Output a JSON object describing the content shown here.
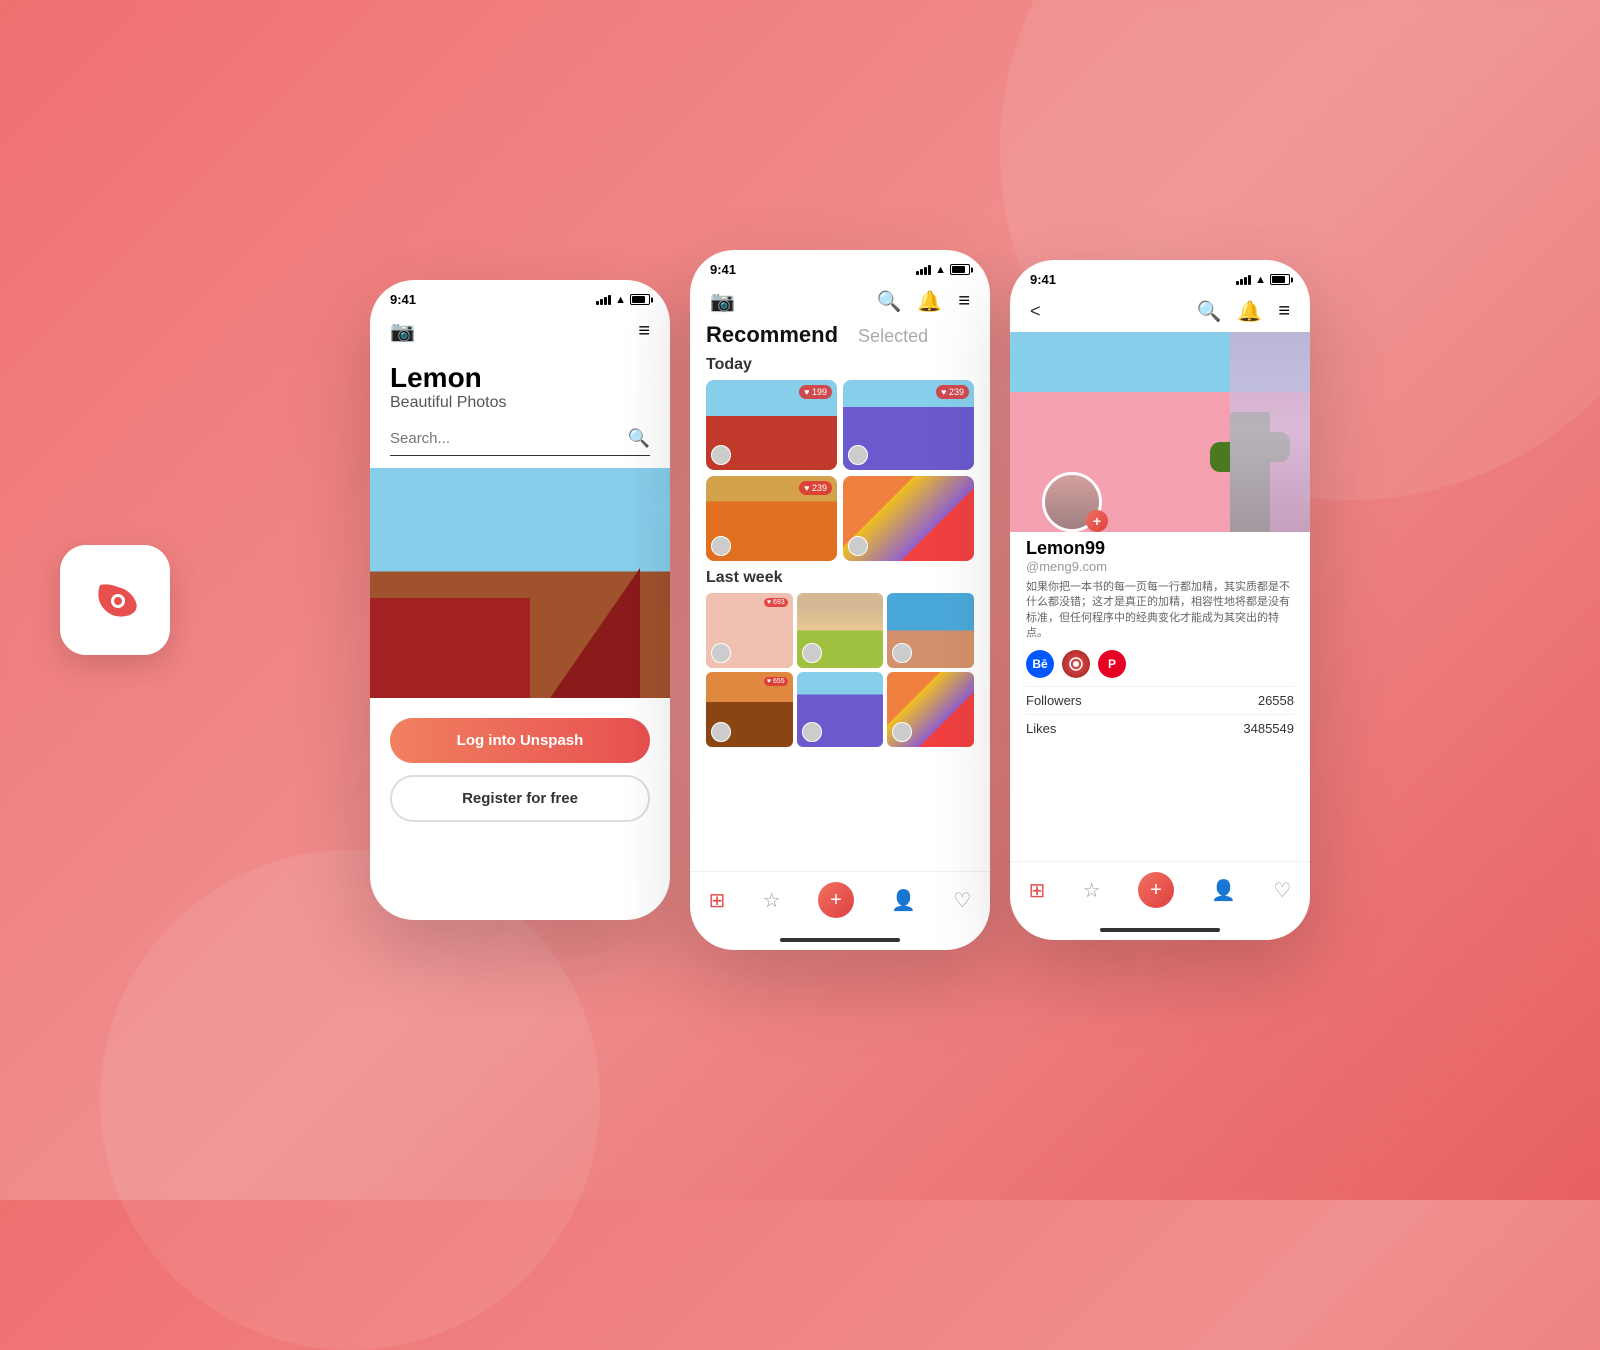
{
  "background": {
    "color1": "#f07070",
    "color2": "#e86060"
  },
  "app_icon": {
    "alt": "Lemon app icon"
  },
  "phone1": {
    "status_time": "9:41",
    "title": "Lemon",
    "subtitle": "Beautiful Photos",
    "search_placeholder": "Search...",
    "btn_login": "Log into Unspash",
    "btn_register": "Register for free"
  },
  "phone2": {
    "status_time": "9:41",
    "tab_recommend": "Recommend",
    "tab_selected": "Selected",
    "section_today": "Today",
    "section_lastweek": "Last week",
    "photo1_likes": "♥ 199",
    "photo2_likes": "♥ 239",
    "photo3_likes": "♥ 239",
    "photo4_likes": "♥ 693",
    "photo5_likes": "♥ 655"
  },
  "phone3": {
    "status_time": "9:41",
    "username": "Lemon99",
    "handle": "@meng9.com",
    "bio": "如果你把一本书的每一页每一行都加精，其实质都是不什么都没错；这才是真正的加精，相容性地将都是没有标准，但任何程序中的经典变化才能成为其突出的特点。",
    "followers_label": "Followers",
    "followers_count": "26558",
    "likes_label": "Likes",
    "likes_count": "3485549"
  },
  "nav": {
    "home_icon": "⊞",
    "star_icon": "☆",
    "add_icon": "+",
    "person_icon": "♡",
    "heart_icon": "♡",
    "camera_icon": "📷",
    "search_icon": "🔍",
    "bell_icon": "🔔",
    "menu_icon": "≡",
    "back_icon": "<"
  }
}
